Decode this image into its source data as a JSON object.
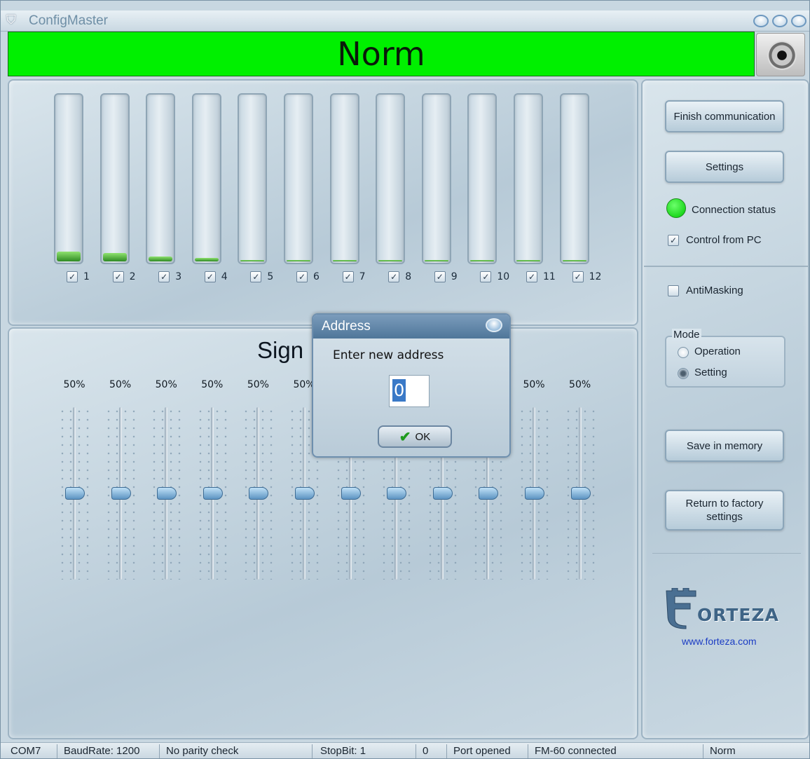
{
  "window": {
    "title": "ConfigMaster"
  },
  "banner": {
    "status": "Norm"
  },
  "channels": {
    "labels": [
      "1",
      "2",
      "3",
      "4",
      "5",
      "6",
      "7",
      "8",
      "9",
      "10",
      "11",
      "12"
    ],
    "levels": [
      0.06,
      0.05,
      0.03,
      0.02,
      0.0,
      0.0,
      0.0,
      0.0,
      0.0,
      0.0,
      0.0,
      0.0
    ],
    "checked": [
      true,
      true,
      true,
      true,
      true,
      true,
      true,
      true,
      true,
      true,
      true,
      true
    ]
  },
  "signal": {
    "title": "Sign",
    "percent_labels": [
      "50%",
      "50%",
      "50%",
      "50%",
      "50%",
      "50%",
      "",
      "",
      "",
      "",
      "50%",
      "50%"
    ],
    "slider_values": [
      0.5,
      0.5,
      0.5,
      0.5,
      0.5,
      0.5,
      0.5,
      0.5,
      0.5,
      0.5,
      0.5,
      0.5
    ]
  },
  "right": {
    "finish_label": "Finish communication",
    "settings_label": "Settings",
    "connection_label": "Connection status",
    "connection_color": "#00e000",
    "control_label": "Control from PC",
    "antimasking_label": "AntiMasking",
    "mode_title": "Mode",
    "mode_operation": "Operation",
    "mode_setting": "Setting",
    "save_label": "Save in memory",
    "factory_label_1": "Return to factory",
    "factory_label_2": "settings",
    "logo_text": "ORTEZA",
    "logo_url": "www.forteza.com"
  },
  "dialog": {
    "title": "Address",
    "prompt": "Enter new address",
    "value": "0",
    "ok_label": "OK"
  },
  "status": {
    "port": "COM7",
    "baud": "BaudRate: 1200",
    "parity": "No parity check",
    "stopbit": "StopBit: 1",
    "zero": "0",
    "port_state": "Port opened",
    "device": "FM-60 connected",
    "state": "Norm"
  }
}
